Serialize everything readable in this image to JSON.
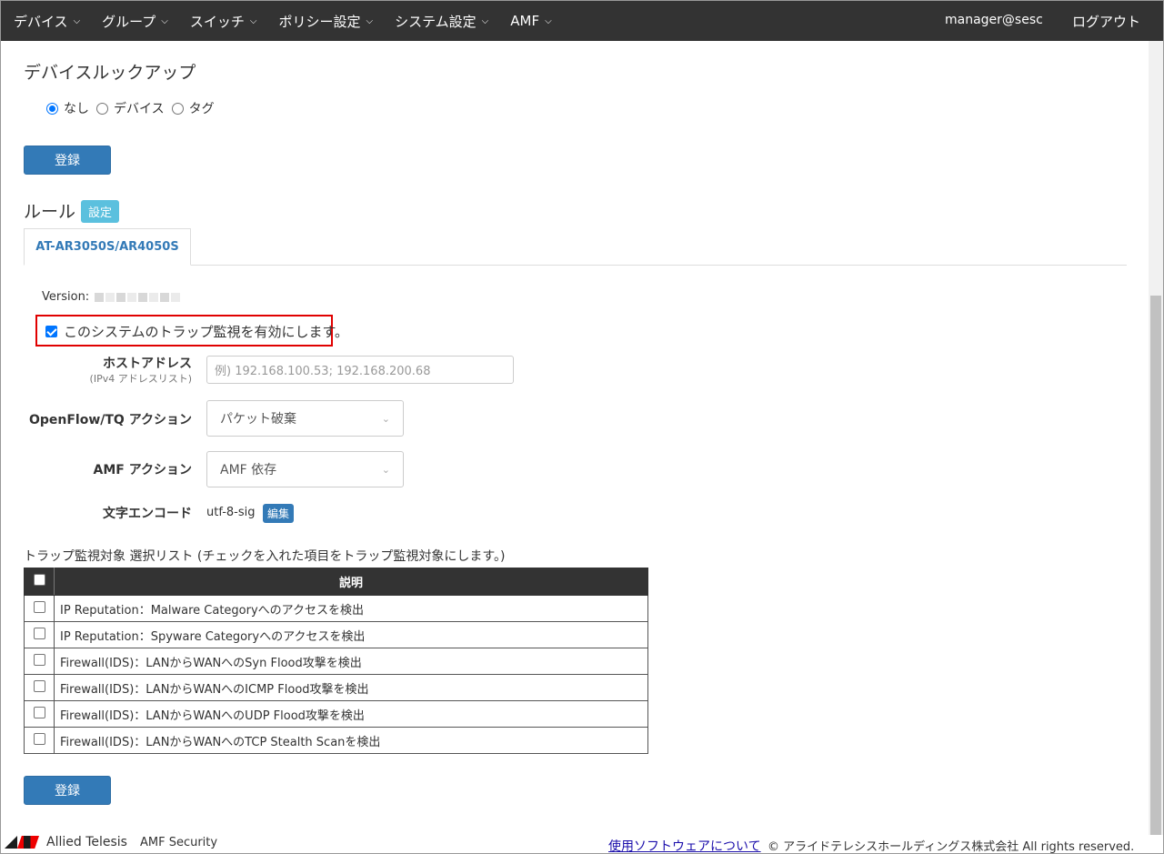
{
  "nav": {
    "items": [
      {
        "label": "デバイス"
      },
      {
        "label": "グループ"
      },
      {
        "label": "スイッチ"
      },
      {
        "label": "ポリシー設定"
      },
      {
        "label": "システム設定"
      },
      {
        "label": "AMF"
      }
    ],
    "user": "manager@sesc",
    "logout": "ログアウト"
  },
  "lookup": {
    "title": "デバイスルックアップ",
    "options": [
      "なし",
      "デバイス",
      "タグ"
    ],
    "selected": "なし",
    "register": "登録"
  },
  "rules": {
    "title": "ルール",
    "settings_badge": "設定",
    "tab": "AT-AR3050S/AR4050S",
    "version_label": "Version:",
    "enable_label": "このシステムのトラップ監視を有効にします。",
    "enable_checked": true,
    "host": {
      "label": "ホストアドレス",
      "sublabel": "(IPv4 アドレスリスト)",
      "placeholder": "例) 192.168.100.53; 192.168.200.68"
    },
    "openflow": {
      "label": "OpenFlow/TQ アクション",
      "value": "パケット破棄"
    },
    "amf": {
      "label": "AMF アクション",
      "value": "AMF 依存"
    },
    "encode": {
      "label": "文字エンコード",
      "value": "utf-8-sig",
      "edit": "編集"
    }
  },
  "trap_list": {
    "title": "トラップ監視対象 選択リスト (チェックを入れた項目をトラップ監視対象にします。)",
    "header": "説明",
    "rows": [
      "IP Reputation：Malware Categoryへのアクセスを検出",
      "IP Reputation：Spyware Categoryへのアクセスを検出",
      "Firewall(IDS)：LANからWANへのSyn Flood攻撃を検出",
      "Firewall(IDS)：LANからWANへのICMP Flood攻撃を検出",
      "Firewall(IDS)：LANからWANへのUDP Flood攻撃を検出",
      "Firewall(IDS)：LANからWANへのTCP Stealth Scanを検出"
    ],
    "register": "登録"
  },
  "footer": {
    "brand": "Allied Telesis",
    "product": "AMF Security",
    "link": "使用ソフトウェアについて",
    "copyright": "© アライドテレシスホールディングス株式会社 All rights reserved."
  }
}
